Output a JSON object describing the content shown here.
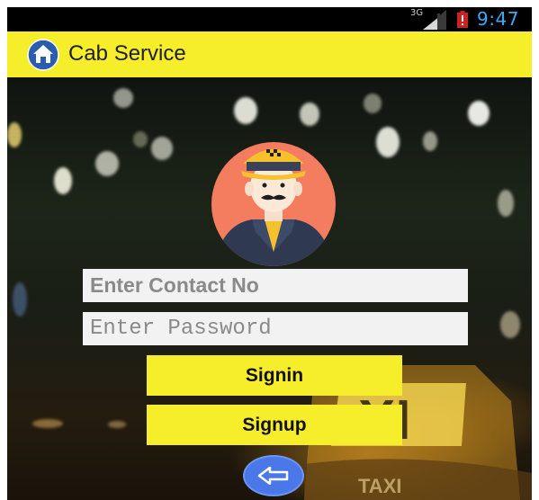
{
  "status_bar": {
    "network_type": "3G",
    "time": "9:47",
    "icons": [
      "signal-icon",
      "battery-alert-icon"
    ]
  },
  "app_bar": {
    "title": "Cab Service",
    "icon": "home-icon"
  },
  "login_form": {
    "contact_placeholder": "Enter Contact No",
    "password_placeholder": "Enter Password",
    "signin_label": "Signin",
    "signup_label": "Signup",
    "back_icon": "arrow-left-icon"
  },
  "colors": {
    "accent_yellow": "#f6ee2b",
    "input_bg": "#f2f2f2",
    "placeholder_text": "#8a8a8a",
    "avatar_circle": "#f47c5f",
    "back_button": "#4a78e8",
    "status_time": "#3fa9f5"
  }
}
